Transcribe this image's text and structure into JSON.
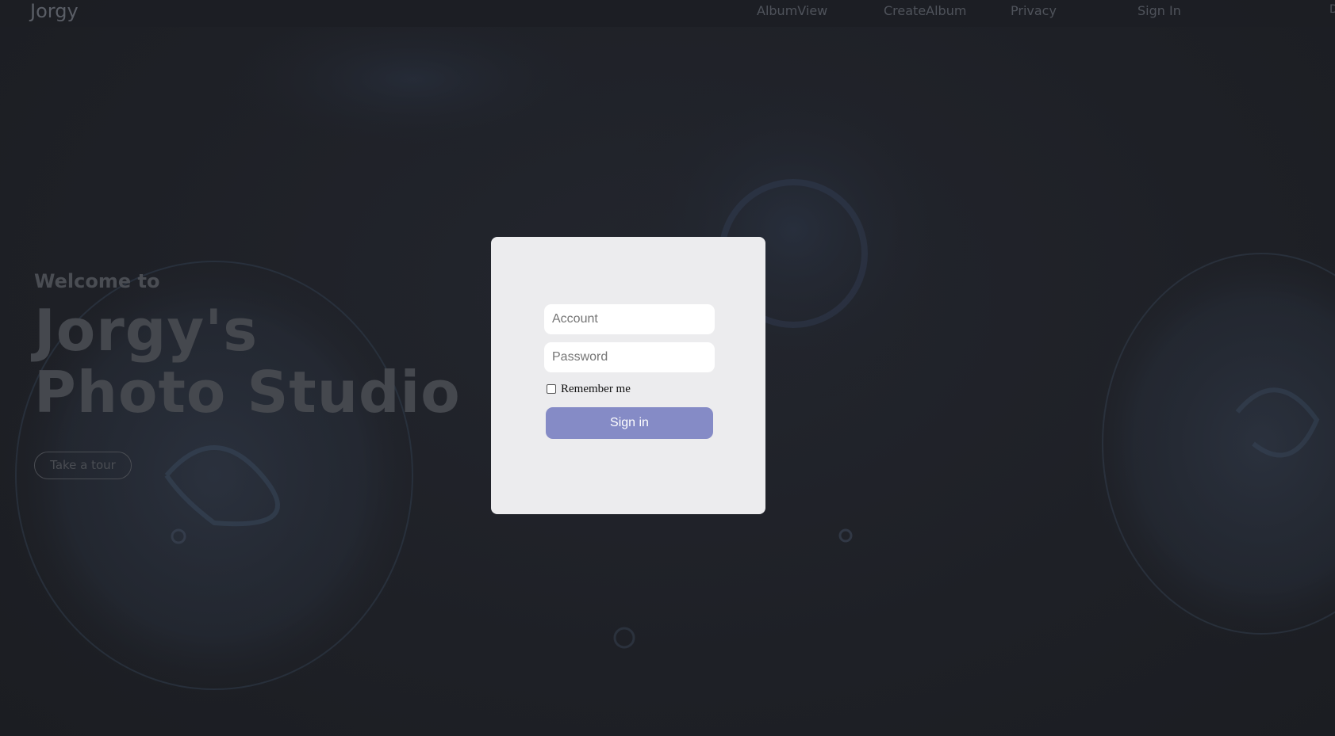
{
  "navbar": {
    "brand": "Jorgy",
    "links": [
      "AlbumView",
      "CreateAlbum",
      "Privacy",
      "Sign In"
    ],
    "edge_text": "D"
  },
  "hero": {
    "welcome": "Welcome to",
    "title_line1": "Jorgy's",
    "title_line2": "Photo Studio",
    "tour_button": "Take a tour"
  },
  "login": {
    "account_placeholder": "Account",
    "account_value": "",
    "password_placeholder": "Password",
    "password_value": "",
    "remember_label": "Remember me",
    "remember_checked": false,
    "submit_label": "Sign in"
  },
  "colors": {
    "background": "#1e2026",
    "modal_bg": "#ececee",
    "button_accent": "#858bc6",
    "muted_text": "#4a4d53"
  }
}
